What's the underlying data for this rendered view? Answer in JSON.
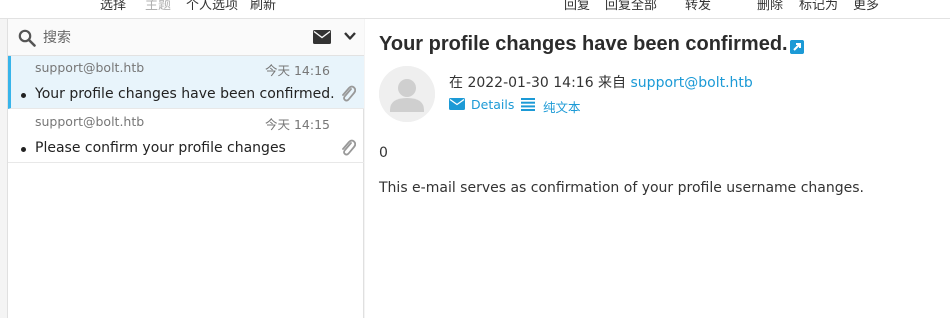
{
  "toolbar": {
    "select": "选择",
    "theme": "主题",
    "settings": "个人选项",
    "refresh": "刷新",
    "reply": "回复",
    "reply_all": "回复全部",
    "forward": "转发",
    "delete": "删除",
    "mark": "标记为",
    "more": "更多"
  },
  "search": {
    "placeholder": "搜索"
  },
  "messages": [
    {
      "from": "support@bolt.htb",
      "date": "今天 14:16",
      "subject": "Your profile changes have been confirmed."
    },
    {
      "from": "support@bolt.htb",
      "date": "今天 14:15",
      "subject": "Please confirm your profile changes"
    }
  ],
  "message": {
    "subject": "Your profile changes have been confirmed.",
    "date_prefix": "在 2022-01-30 14:16 来自 ",
    "from": "support@bolt.htb",
    "details_label": "Details",
    "plaintext_label": "纯文本",
    "body_line1": "0",
    "body_line2": "This e-mail serves as confirmation of your profile username changes."
  },
  "colors": {
    "accent": "#1c9ad6",
    "selected_row": "#e8f4fb"
  }
}
